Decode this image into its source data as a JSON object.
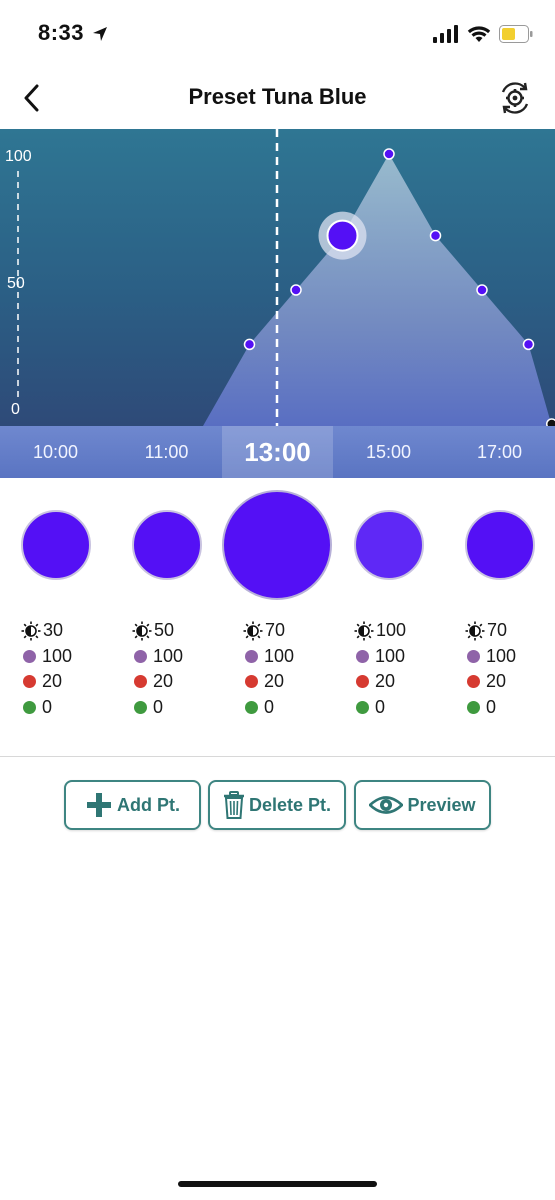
{
  "status_bar": {
    "time": "8:33",
    "icons": [
      "location-arrow-icon",
      "cellular-signal-icon",
      "wifi-icon",
      "battery-icon"
    ],
    "battery_color": "#f2cf2f"
  },
  "header": {
    "title": "Preset Tuna Blue",
    "back_icon": "chevron-left-icon",
    "settings_icon": "gear-sync-icon"
  },
  "chart_data": {
    "type": "area",
    "y_ticks": [
      "100",
      "50",
      "0"
    ],
    "ylim": [
      0,
      100
    ],
    "points": [
      {
        "time": "10:00",
        "value": 0
      },
      {
        "time": "11:00",
        "value": 30
      },
      {
        "time": "12:00",
        "value": 50
      },
      {
        "time": "13:00",
        "value": 70,
        "selected": true
      },
      {
        "time": "14:00",
        "value": 100
      },
      {
        "time": "15:00",
        "value": 70
      },
      {
        "time": "16:00",
        "value": 50
      },
      {
        "time": "17:00",
        "value": 30
      },
      {
        "time": "17:30",
        "value": 0
      }
    ],
    "fill_color": "#9ebfd0",
    "point_color": "#5410f5"
  },
  "timeline": {
    "labels": [
      "10:00",
      "11:00",
      "13:00",
      "15:00",
      "17:00"
    ],
    "selected": "13:00"
  },
  "channels": [
    {
      "brightness": "30",
      "purple": "100",
      "red": "20",
      "green": "0",
      "color": "#5410f5"
    },
    {
      "brightness": "50",
      "purple": "100",
      "red": "20",
      "green": "0",
      "color": "#5410f5"
    },
    {
      "brightness": "70",
      "purple": "100",
      "red": "20",
      "green": "0",
      "color": "#5410f5",
      "selected": true
    },
    {
      "brightness": "100",
      "purple": "100",
      "red": "20",
      "green": "0",
      "color": "#5f28f6"
    },
    {
      "brightness": "70",
      "purple": "100",
      "red": "20",
      "green": "0",
      "color": "#5410f5"
    }
  ],
  "channel_colors": {
    "purple": "#8f63a8",
    "red": "#d63a31",
    "green": "#3f9a3f"
  },
  "actions": {
    "add_label": "Add Pt.",
    "delete_label": "Delete Pt.",
    "preview_label": "Preview",
    "accent": "#3e8582"
  }
}
